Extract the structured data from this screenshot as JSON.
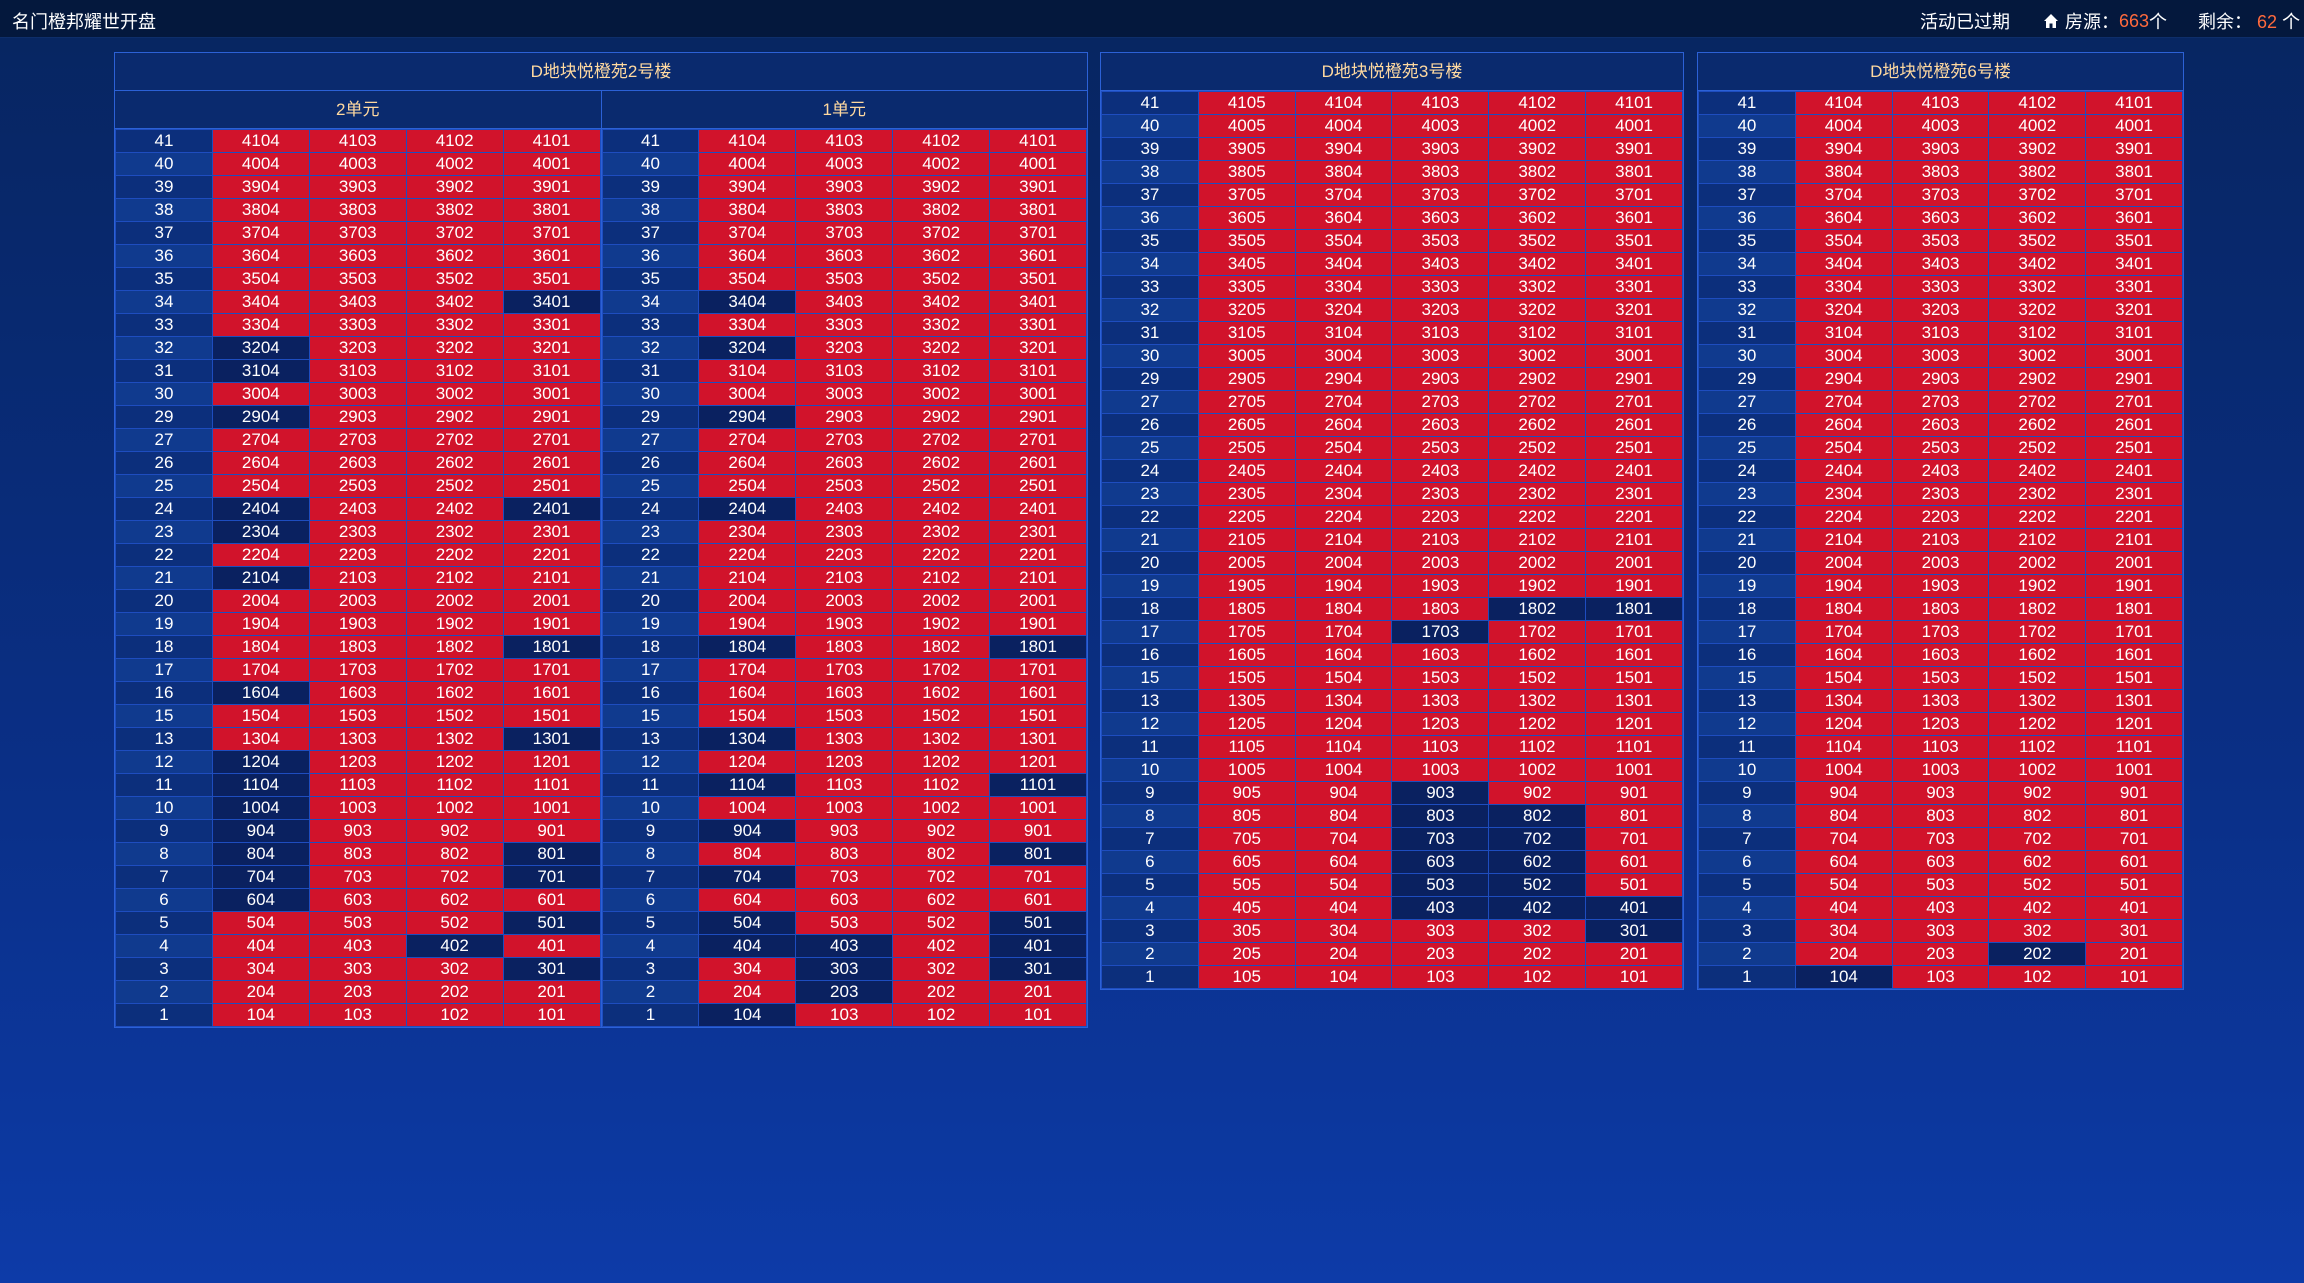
{
  "header": {
    "app_title": "名门橙邦耀世开盘",
    "status": "活动已过期",
    "rooms_label": "房源：",
    "rooms_count": "663",
    "rooms_unit": "个",
    "remain_label": "剩余：",
    "remain_count": "62",
    "remain_unit": "个",
    "home_icon": "home-icon"
  },
  "colors": {
    "sold": "#d1132b",
    "available": "#0a2160",
    "count_accent": "#ff6a3d"
  },
  "buildings": [
    {
      "title": "D地块悦橙苑2号楼",
      "floors": [
        "41",
        "40",
        "39",
        "38",
        "37",
        "36",
        "35",
        "34",
        "33",
        "32",
        "31",
        "30",
        "29",
        "27",
        "26",
        "25",
        "24",
        "23",
        "22",
        "21",
        "20",
        "19",
        "18",
        "17",
        "16",
        "15",
        "13",
        "12",
        "11",
        "10",
        "9",
        "8",
        "7",
        "6",
        "5",
        "4",
        "3",
        "2",
        "1"
      ],
      "units": [
        {
          "label": "2单元",
          "available": [
            "3401",
            "3204",
            "3104",
            "2904",
            "2404",
            "2401",
            "2304",
            "2104",
            "1801",
            "1604",
            "1301",
            "1204",
            "1104",
            "1004",
            "904",
            "804",
            "801",
            "704",
            "701",
            "604",
            "501",
            "402",
            "301"
          ]
        },
        {
          "label": "1单元",
          "available": [
            "3404",
            "3204",
            "2904",
            "2404",
            "1804",
            "1801",
            "1304",
            "1104",
            "1101",
            "904",
            "801",
            "704",
            "504",
            "501",
            "404",
            "403",
            "401",
            "303",
            "301",
            "203",
            "104"
          ]
        }
      ]
    },
    {
      "title": "D地块悦橙苑3号楼",
      "floors": [
        "41",
        "40",
        "39",
        "38",
        "37",
        "36",
        "35",
        "34",
        "33",
        "32",
        "31",
        "30",
        "29",
        "27",
        "26",
        "25",
        "24",
        "23",
        "22",
        "21",
        "20",
        "19",
        "18",
        "17",
        "16",
        "15",
        "13",
        "12",
        "11",
        "10",
        "9",
        "8",
        "7",
        "6",
        "5",
        "4",
        "3",
        "2",
        "1"
      ],
      "units": [
        {
          "label": "",
          "cols": 5,
          "available": [
            "1802",
            "1801",
            "1703",
            "903",
            "803",
            "802",
            "703",
            "702",
            "603",
            "602",
            "503",
            "502",
            "403",
            "402",
            "401",
            "301"
          ]
        }
      ]
    },
    {
      "title": "D地块悦橙苑6号楼",
      "floors": [
        "41",
        "40",
        "39",
        "38",
        "37",
        "36",
        "35",
        "34",
        "33",
        "32",
        "31",
        "30",
        "29",
        "27",
        "26",
        "25",
        "24",
        "23",
        "22",
        "21",
        "20",
        "19",
        "18",
        "17",
        "16",
        "15",
        "13",
        "12",
        "11",
        "10",
        "9",
        "8",
        "7",
        "6",
        "5",
        "4",
        "3",
        "2",
        "1"
      ],
      "units": [
        {
          "label": "",
          "available": [
            "202",
            "104"
          ]
        }
      ]
    }
  ]
}
